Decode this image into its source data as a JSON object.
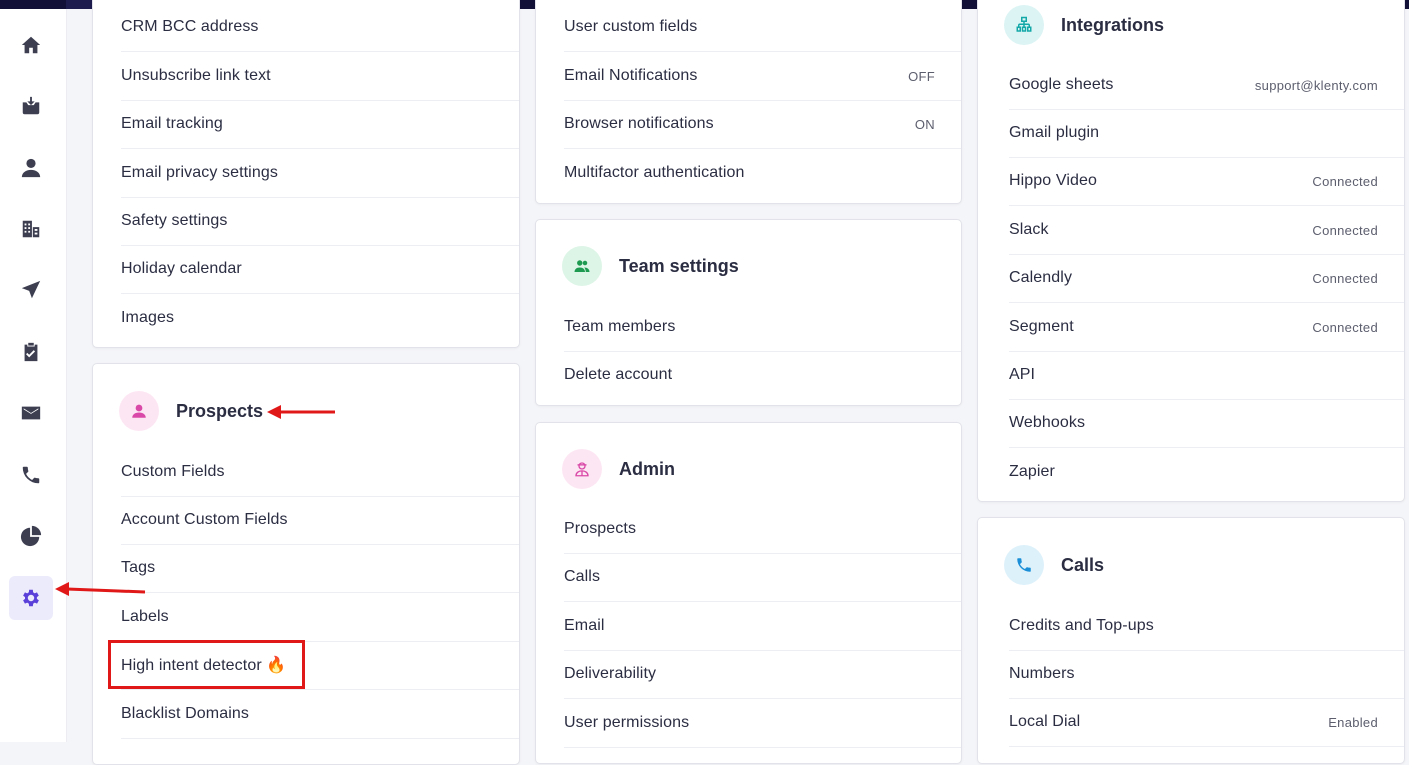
{
  "nav": {
    "items": [
      {
        "name": "home-icon"
      },
      {
        "name": "inbox-icon"
      },
      {
        "name": "user-icon"
      },
      {
        "name": "company-icon"
      },
      {
        "name": "send-icon"
      },
      {
        "name": "tasks-icon"
      },
      {
        "name": "mail-icon"
      },
      {
        "name": "phone-icon"
      },
      {
        "name": "reports-icon"
      },
      {
        "name": "settings-icon",
        "active": true
      }
    ]
  },
  "col1": {
    "top_card": {
      "rows": [
        "CRM BCC address",
        "Unsubscribe link text",
        "Email tracking",
        "Email privacy settings",
        "Safety settings",
        "Holiday calendar",
        "Images"
      ]
    },
    "prospects_card": {
      "title": "Prospects",
      "icon": "user-icon",
      "rows": [
        "Custom Fields",
        "Account Custom Fields",
        "Tags",
        "Labels",
        "High intent detector 🔥",
        "Blacklist Domains"
      ]
    }
  },
  "col2": {
    "top_card": {
      "rows": [
        {
          "label": "User custom fields",
          "status": ""
        },
        {
          "label": "Email Notifications",
          "status": "OFF"
        },
        {
          "label": "Browser notifications",
          "status": "ON"
        },
        {
          "label": "Multifactor authentication",
          "status": ""
        }
      ]
    },
    "team_card": {
      "title": "Team settings",
      "icon": "team-icon",
      "rows": [
        "Team members",
        "Delete account"
      ]
    },
    "admin_card": {
      "title": "Admin",
      "icon": "admin-icon",
      "rows": [
        "Prospects",
        "Calls",
        "Email",
        "Deliverability",
        "User permissions"
      ]
    }
  },
  "col3": {
    "integrations_card": {
      "title": "Integrations",
      "icon": "integrations-icon",
      "rows": [
        {
          "label": "Google sheets",
          "status": "support@klenty.com"
        },
        {
          "label": "Gmail plugin",
          "status": ""
        },
        {
          "label": "Hippo Video",
          "status": "Connected"
        },
        {
          "label": "Slack",
          "status": "Connected"
        },
        {
          "label": "Calendly",
          "status": "Connected"
        },
        {
          "label": "Segment",
          "status": "Connected"
        },
        {
          "label": "API",
          "status": ""
        },
        {
          "label": "Webhooks",
          "status": ""
        },
        {
          "label": "Zapier",
          "status": ""
        }
      ]
    },
    "calls_card": {
      "title": "Calls",
      "icon": "phone-icon",
      "rows": [
        {
          "label": "Credits and Top-ups",
          "status": ""
        },
        {
          "label": "Numbers",
          "status": ""
        },
        {
          "label": "Local Dial",
          "status": "Enabled"
        }
      ]
    }
  },
  "colors": {
    "accent": "#5a3fd8",
    "annotation_red": "#e01818",
    "prospects_icon_bg": "#fde6f3",
    "team_icon_bg": "#dcf5e6",
    "admin_icon_bg": "#fde6f3",
    "integrations_icon_bg": "#dcf4f4",
    "calls_icon_bg": "#ddf1fb"
  }
}
